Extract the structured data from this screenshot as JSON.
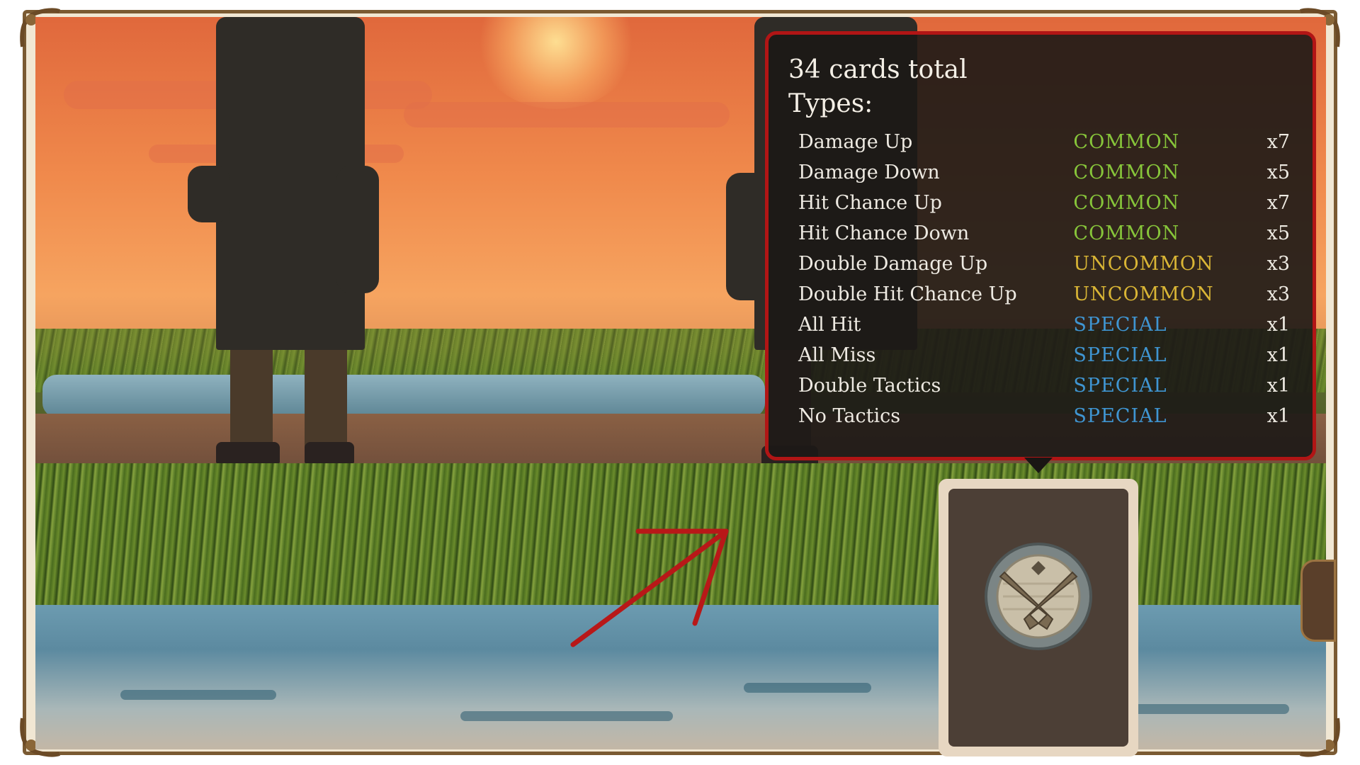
{
  "tooltip": {
    "total_label": "34 cards total",
    "types_label": "Types:",
    "rarity_colors": {
      "COMMON": "#87c53a",
      "UNCOMMON": "#d9b535",
      "SPECIAL": "#3f95d2"
    },
    "cards": [
      {
        "name": "Damage Up",
        "rarity": "COMMON",
        "count": "x7"
      },
      {
        "name": "Damage Down",
        "rarity": "COMMON",
        "count": "x5"
      },
      {
        "name": "Hit Chance Up",
        "rarity": "COMMON",
        "count": "x7"
      },
      {
        "name": "Hit Chance Down",
        "rarity": "COMMON",
        "count": "x5"
      },
      {
        "name": "Double Damage Up",
        "rarity": "UNCOMMON",
        "count": "x3"
      },
      {
        "name": "Double Hit Chance Up",
        "rarity": "UNCOMMON",
        "count": "x3"
      },
      {
        "name": "All Hit",
        "rarity": "SPECIAL",
        "count": "x1"
      },
      {
        "name": "All Miss",
        "rarity": "SPECIAL",
        "count": "x1"
      },
      {
        "name": "Double Tactics",
        "rarity": "SPECIAL",
        "count": "x1"
      },
      {
        "name": "No Tactics",
        "rarity": "SPECIAL",
        "count": "x1"
      }
    ]
  },
  "deck": {
    "emblem_icon": "crossed-pistols-icon"
  },
  "annotation": {
    "arrow_color": "#b81818"
  },
  "frame": {
    "border_color": "#7a5a32"
  }
}
